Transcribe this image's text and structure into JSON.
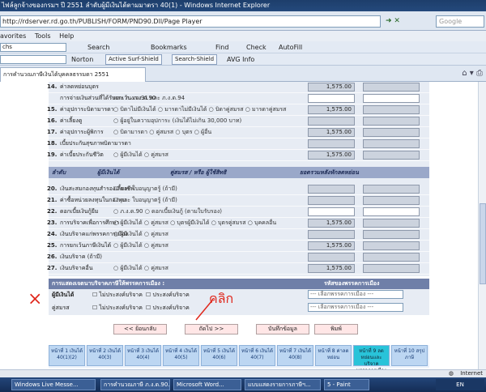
{
  "window": {
    "title": "ไฟล์ลูกจ้างของกรมฯ ปี 2551 ลำดับผู้มีเงินได้ตามมาตรา 40(1) - Windows Internet Explorer"
  },
  "address": {
    "url": "http://rdserver.rd.go.th/PUBLISH/FORM/PND90.Dll/Page Player",
    "search_placeholder": "Google"
  },
  "menu": [
    "avorites",
    "Tools",
    "Help"
  ],
  "toolbar1": {
    "field": "chs",
    "search_label": "Search",
    "bookmarks": "Bookmarks",
    "find": "Find",
    "check": "Check",
    "autofill": "AutoFill"
  },
  "toolbar2": {
    "field": "Norton",
    "active_surf": "Active Surf-Shield",
    "search_shield": "Search-Shield",
    "avg_info": "AVG Info"
  },
  "tab": {
    "label": "การคำนวณภาษีเงินได้บุคคลธรรมดา 2551"
  },
  "rows": [
    {
      "num": "14.",
      "label": "ค่าลดหย่อนบุตร",
      "opts": "",
      "value": "1,575.00",
      "blank": false
    },
    {
      "num": "",
      "label": "การจ่ายเงินส่วนที่ได้รับยกเว้น ภ.ง.ด.90",
      "opts": "และ ภ.ง.ด.91 และ ภ.ง.ด.94",
      "value": "",
      "blank": true
    },
    {
      "num": "15.",
      "label": "ค่าอุปการะบิดามารดา",
      "opts": "○ บิดาไม่มีเงินได้  ○ มารดาไม่มีเงินได้  ○ บิดาคู่สมรส  ○ มารดาคู่สมรส",
      "value": "1,575.00",
      "blank": false
    },
    {
      "num": "16.",
      "label": "ค่าเลี้ยงดู",
      "opts": "○ ผู้อยู่ในความอุปการะ (เงินได้ไม่เกิน 30,000 บาท)",
      "value": "",
      "blank": false
    },
    {
      "num": "17.",
      "label": "ค่าอุปการะผู้พิการ",
      "opts": "○ บิดามารดา  ○ คู่สมรส  ○ บุตร  ○ ผู้อื่น",
      "value": "1,575.00",
      "blank": false
    },
    {
      "num": "18.",
      "label": "เบี้ยประกันสุขภาพบิดามารดา",
      "opts": "",
      "value": "",
      "blank": false
    },
    {
      "num": "19.",
      "label": "ค่าเบี้ยประกันชีวิต",
      "opts": "○ ผู้มีเงินได้  ○ คู่สมรส",
      "value": "1,575.00",
      "blank": false
    },
    {
      "num": "20.",
      "label": "เงินสะสมกองทุนสำรองเลี้ยงชีพ",
      "opts": "☐ และ ใบอนุญาตรู้ (ถ้ามี)",
      "value": "",
      "blank": false
    },
    {
      "num": "21.",
      "label": "ค่าซื้อหน่วยลงทุนในกองทุน",
      "opts": "☐ และ ใบอนุญาตรู้ (ถ้ามี)",
      "value": "",
      "blank": false
    },
    {
      "num": "22.",
      "label": "ดอกเบี้ยเงินกู้ยืม",
      "opts": "○ ภ.ง.ด.90  ○ ดอกเบี้ยเงินกู้ (ตามใบรับรอง)",
      "value": "",
      "blank": true
    },
    {
      "num": "23.",
      "label": "การบริจาคเพื่อการศึกษา",
      "opts": "○ ผู้มีเงินได้  ○ คู่สมรส  ○ บุตรผู้มีเงินได้  ○ บุตรคู่สมรส  ○ บุคคลอื่น",
      "value": "1,575.00",
      "blank": false
    },
    {
      "num": "24.",
      "label": "เงินบริจาคแก่พรรคการเมือง",
      "opts": "○ ผู้มีเงินได้  ○ คู่สมรส",
      "value": "",
      "blank": false
    },
    {
      "num": "25.",
      "label": "การยกเว้นภาษีเงินได้",
      "opts": "○ ผู้มีเงินได้  ○ คู่สมรส",
      "value": "1,575.00",
      "blank": false
    },
    {
      "num": "26.",
      "label": "เงินบริจาค (ถ้ามี)",
      "opts": "",
      "value": "",
      "blank": false
    },
    {
      "num": "27.",
      "label": "เงินบริจาคอื่น",
      "opts": "○ ผู้มีเงินได้  ○ คู่สมรส",
      "value": "1,575.00",
      "blank": false
    }
  ],
  "header_row": {
    "a": "ลำดับ",
    "b": "ผู้มีเงินได้",
    "c": "คู่สมรส / หรือ ผู้ใช้สิทธิ",
    "d": "ยอดรวมหลังหักลดหย่อน"
  },
  "section": {
    "title": "การแสดงเจตนาบริจาคภาษีให้พรรคการเมือง :",
    "right": "รหัสของพรรคการเมือง"
  },
  "party": {
    "self_label": "ผู้มีเงินได้",
    "spouse_label": "คู่สมรส",
    "opt_a": "ไม่ประสงค์บริจาค",
    "opt_b": "ประสงค์บริจาค",
    "dropdown": "--- เลือกพรรคการเมือง ---"
  },
  "nav": {
    "prev": "<< ย้อนกลับ",
    "next": "ถัดไป >>",
    "save": "บันทึกข้อมูล",
    "print": "พิมพ์"
  },
  "pages": [
    "หน้าที่ 1 เงินได้ 40(1)(2)",
    "หน้าที่ 2 เงินได้ 40(3)",
    "หน้าที่ 3 เงินได้ 40(4)",
    "หน้าที่ 4 เงินได้ 40(5)",
    "หน้าที่ 5 เงินได้ 40(6)",
    "หน้าที่ 6 เงินได้ 40(7)",
    "หน้าที่ 7 เงินได้ 40(8)",
    "หน้าที่ 8 ค่าลดหย่อน",
    "หน้าที่ 9 ลดหย่อนและบริจาคพรรคการเมือง",
    "หน้าที่ 10 สรุปภาษี"
  ],
  "annotation": {
    "mark": "×",
    "text": "คลิก"
  },
  "status": {
    "zone": "Internet"
  },
  "taskbar": [
    "Windows Live Messe...",
    "การคำนวณภาษี ภ.ง.ด.90...",
    "Microsoft Word...",
    "แบบแสดงรายการภาษีฯ...",
    "5 - Paint"
  ],
  "clock": "EN"
}
